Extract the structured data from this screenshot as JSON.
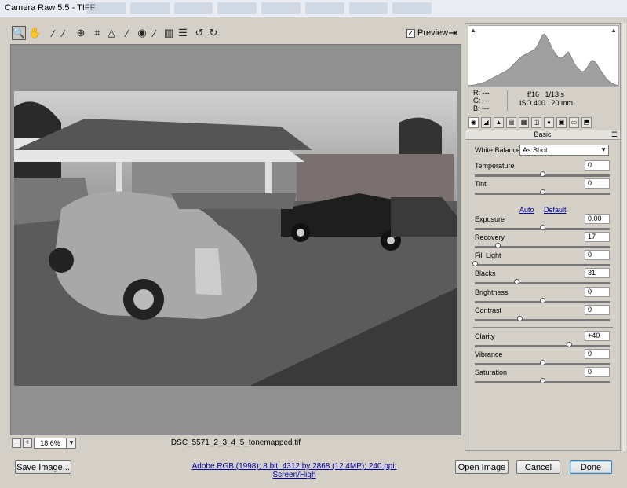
{
  "window": {
    "title": "Camera Raw 5.5  -  TIFF"
  },
  "toolbar": {
    "tools": [
      {
        "name": "zoom-tool",
        "glyph": "🔍",
        "active": true
      },
      {
        "name": "hand-tool",
        "glyph": "✋"
      },
      {
        "name": "white-balance-tool",
        "glyph": "⁄"
      },
      {
        "name": "color-sampler-tool",
        "glyph": "⁄"
      },
      {
        "name": "targeted-adjustment-tool",
        "glyph": "⊕"
      },
      {
        "name": "crop-tool",
        "glyph": "⌗"
      },
      {
        "name": "straighten-tool",
        "glyph": "△"
      },
      {
        "name": "spot-removal-tool",
        "glyph": "⁄"
      },
      {
        "name": "red-eye-tool",
        "glyph": "◉"
      },
      {
        "name": "adjustment-brush-tool",
        "glyph": "⁄"
      },
      {
        "name": "graduated-filter-tool",
        "glyph": "▥"
      },
      {
        "name": "preferences-tool",
        "glyph": "☰"
      },
      {
        "name": "rotate-left-tool",
        "glyph": "↺"
      },
      {
        "name": "rotate-right-tool",
        "glyph": "↻"
      }
    ],
    "preview_label": "Preview",
    "preview_checked": true
  },
  "zoom": {
    "minus": "−",
    "plus": "+",
    "value": "18.6%"
  },
  "filename": "DSC_5571_2_3_4_5_tonemapped.tif",
  "workflow_link": "Adobe RGB (1998); 8 bit; 4312 by 2868 (12.4MP); 240 ppi; Screen/High",
  "buttons": {
    "save": "Save Image...",
    "open": "Open Image",
    "cancel": "Cancel",
    "done": "Done"
  },
  "histogram": {
    "bins": [
      2,
      2,
      3,
      3,
      4,
      5,
      6,
      7,
      8,
      10,
      12,
      14,
      16,
      18,
      20,
      22,
      24,
      26,
      28,
      30,
      33,
      36,
      40,
      44,
      48,
      52,
      55,
      58,
      60,
      62,
      64,
      66,
      68,
      70,
      75,
      82,
      90,
      98,
      100,
      95,
      88,
      80,
      72,
      65,
      60,
      56,
      54,
      55,
      58,
      62,
      66,
      60,
      52,
      44,
      38,
      34,
      30,
      28,
      30,
      34,
      40,
      46,
      50,
      48,
      44,
      38,
      32,
      26,
      20,
      15,
      11,
      8,
      6,
      4,
      3,
      2
    ]
  },
  "readout": {
    "r": "R:  ---",
    "g": "G:  ---",
    "b": "B:  ---",
    "aperture": "f/16",
    "shutter": "1/13 s",
    "iso": "ISO 400",
    "focal": "20 mm"
  },
  "panel": {
    "title": "Basic"
  },
  "white_balance": {
    "label": "White Balance:",
    "value": "As Shot"
  },
  "auto_label": "Auto",
  "default_label": "Default",
  "sliders": [
    {
      "key": "temperature",
      "label": "Temperature",
      "value": "0",
      "pos": 0.5,
      "track": "tr-temp"
    },
    {
      "key": "tint",
      "label": "Tint",
      "value": "0",
      "pos": 0.5,
      "track": "tr-tint"
    },
    {
      "key": "exposure",
      "label": "Exposure",
      "value": "0.00",
      "pos": 0.5,
      "track": "tr-dark"
    },
    {
      "key": "recovery",
      "label": "Recovery",
      "value": "17",
      "pos": 0.17,
      "track": "tr-dark"
    },
    {
      "key": "fill-light",
      "label": "Fill Light",
      "value": "0",
      "pos": 0.0,
      "track": "tr-dark"
    },
    {
      "key": "blacks",
      "label": "Blacks",
      "value": "31",
      "pos": 0.31,
      "track": "tr-dark"
    },
    {
      "key": "brightness",
      "label": "Brightness",
      "value": "0",
      "pos": 0.5,
      "track": "tr-dark"
    },
    {
      "key": "contrast",
      "label": "Contrast",
      "value": "0",
      "pos": 0.33,
      "track": "tr-dark"
    },
    {
      "key": "clarity",
      "label": "Clarity",
      "value": "+40",
      "pos": 0.7,
      "track": "tr-light"
    },
    {
      "key": "vibrance",
      "label": "Vibrance",
      "value": "0",
      "pos": 0.5,
      "track": "tr-vib"
    },
    {
      "key": "saturation",
      "label": "Saturation",
      "value": "0",
      "pos": 0.5,
      "track": "tr-sat"
    }
  ]
}
